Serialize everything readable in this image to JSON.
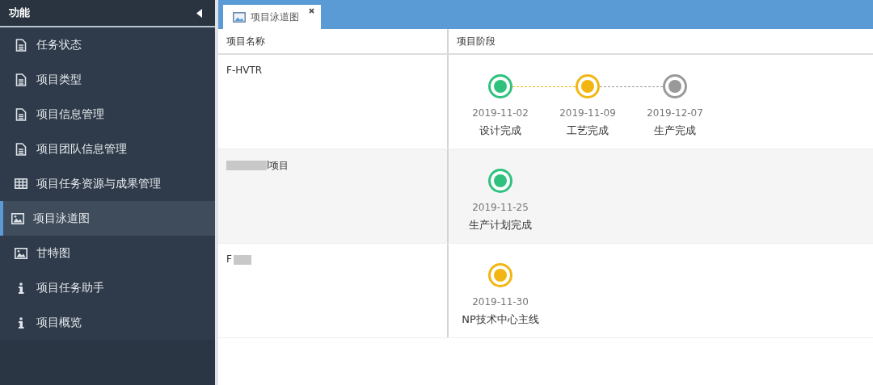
{
  "sidebar": {
    "title": "功能",
    "items": [
      {
        "label": "任务状态",
        "kind": "document",
        "selected": false
      },
      {
        "label": "项目类型",
        "kind": "document",
        "selected": false
      },
      {
        "label": "项目信息管理",
        "kind": "document",
        "selected": false
      },
      {
        "label": "项目团队信息管理",
        "kind": "document",
        "selected": false
      },
      {
        "label": "项目任务资源与成果管理",
        "kind": "table",
        "selected": false
      },
      {
        "label": "项目泳道图",
        "kind": "image",
        "selected": true
      },
      {
        "label": "甘特图",
        "kind": "image",
        "selected": false
      },
      {
        "label": "项目任务助手",
        "kind": "info",
        "selected": false
      },
      {
        "label": "项目概览",
        "kind": "info",
        "selected": false
      }
    ]
  },
  "tabs": [
    {
      "label": "项目泳道图",
      "selected": true
    }
  ],
  "table": {
    "columns": [
      "项目名称",
      "项目阶段"
    ],
    "rows": [
      {
        "name": "F-HVTR",
        "redacted_start": false,
        "redacted_end": false,
        "stages": [
          {
            "date": "2019-11-02",
            "label": "设计完成",
            "color": "#2ec27e"
          },
          {
            "date": "2019-11-09",
            "label": "工艺完成",
            "color": "#f2b612"
          },
          {
            "date": "2019-12-07",
            "label": "生产完成",
            "color": "#999999"
          }
        ]
      },
      {
        "name": "l项目",
        "redacted_start": true,
        "redacted_end": false,
        "stages": [
          {
            "date": "2019-11-25",
            "label": "生产计划完成",
            "color": "#2ec27e"
          }
        ]
      },
      {
        "name": "F",
        "redacted_start": false,
        "redacted_end": true,
        "stages": [
          {
            "date": "2019-11-30",
            "label": "NP技术中心主线",
            "color": "#f2b612"
          }
        ]
      }
    ]
  }
}
